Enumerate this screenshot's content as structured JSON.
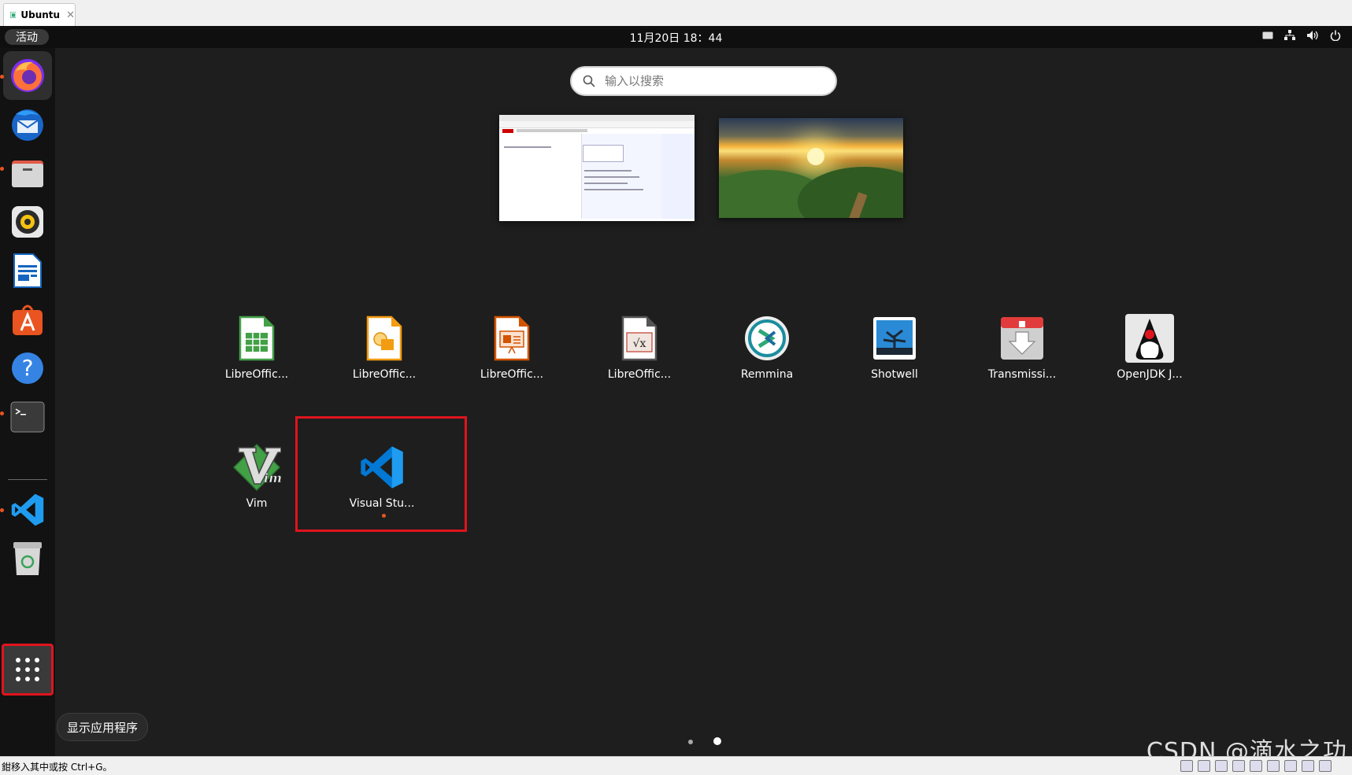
{
  "vm_tab": {
    "title": "Ubuntu"
  },
  "topbar": {
    "activities": "活动",
    "clock": "11月20日  18：44"
  },
  "search": {
    "placeholder": "输入以搜索"
  },
  "dock": {
    "items": [
      "firefox",
      "thunderbird",
      "files",
      "rhythmbox",
      "libreoffice-writer",
      "ubuntu-software",
      "help",
      "terminal",
      "visual-studio-code",
      "trash"
    ],
    "show_apps_tooltip": "显示应用程序"
  },
  "apps": [
    {
      "label": "LibreOffic...",
      "icon": "libreoffice-calc-icon"
    },
    {
      "label": "LibreOffic...",
      "icon": "libreoffice-draw-icon"
    },
    {
      "label": "LibreOffic...",
      "icon": "libreoffice-impress-icon"
    },
    {
      "label": "LibreOffic...",
      "icon": "libreoffice-math-icon"
    },
    {
      "label": "Remmina",
      "icon": "remmina-icon"
    },
    {
      "label": "Shotwell",
      "icon": "shotwell-icon"
    },
    {
      "label": "Transmissi...",
      "icon": "transmission-icon"
    },
    {
      "label": "OpenJDK J...",
      "icon": "openjdk-icon"
    },
    {
      "label": "Vim",
      "icon": "vim-icon"
    },
    {
      "label": "Visual Stu...",
      "icon": "vscode-icon"
    }
  ],
  "statusbar": {
    "message": "鉗移入其中或按 Ctrl+G。"
  },
  "watermark": "CSDN @滴水之功",
  "colors": {
    "accent": "#e95420",
    "highlight": "#e0141e",
    "vscode": "#0078d4"
  }
}
